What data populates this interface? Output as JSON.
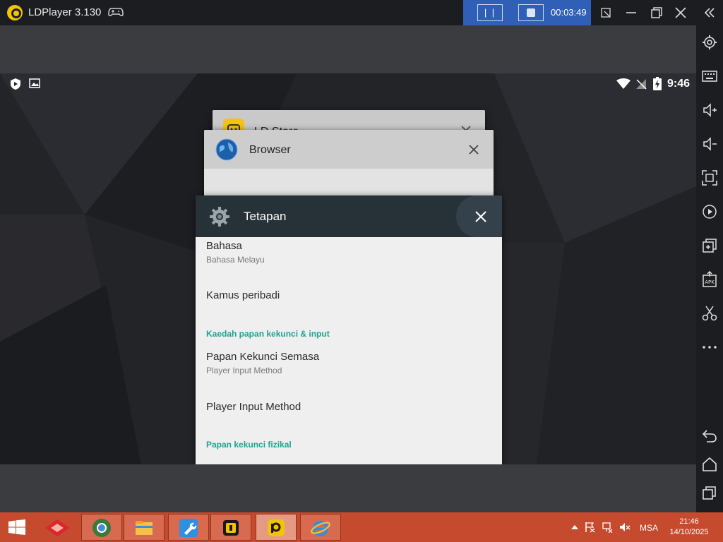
{
  "window": {
    "app_title": "LDPlayer 3.130",
    "record_pause_label": "| |",
    "record_time": "00:03:49"
  },
  "android": {
    "status_time": "9:46"
  },
  "recents": {
    "cards": [
      {
        "app": "LD Store",
        "icon": "ld-store-icon"
      },
      {
        "app": "Browser",
        "icon": "browser-globe-icon"
      },
      {
        "app": "Tetapan",
        "icon": "settings-gear-icon"
      }
    ]
  },
  "settings": {
    "items": [
      {
        "title": "Bahasa",
        "summary": "Bahasa Melayu"
      },
      {
        "title": "Kamus peribadi",
        "summary": ""
      },
      {
        "category": "Kaedah papan kekunci & input"
      },
      {
        "title": "Papan Kekunci Semasa",
        "summary": "Player Input Method"
      },
      {
        "title": "Player Input Method",
        "summary": ""
      },
      {
        "category": "Papan kekunci fizikal"
      }
    ]
  },
  "taskbar": {
    "language": "MSA",
    "clock_time": "21:46",
    "clock_date": "14/10/2025"
  },
  "colors": {
    "record_panel": "#2f5fb7",
    "settings_header": "#263238",
    "category_accent": "#1ea38f",
    "taskbar": "#c54a2e"
  }
}
